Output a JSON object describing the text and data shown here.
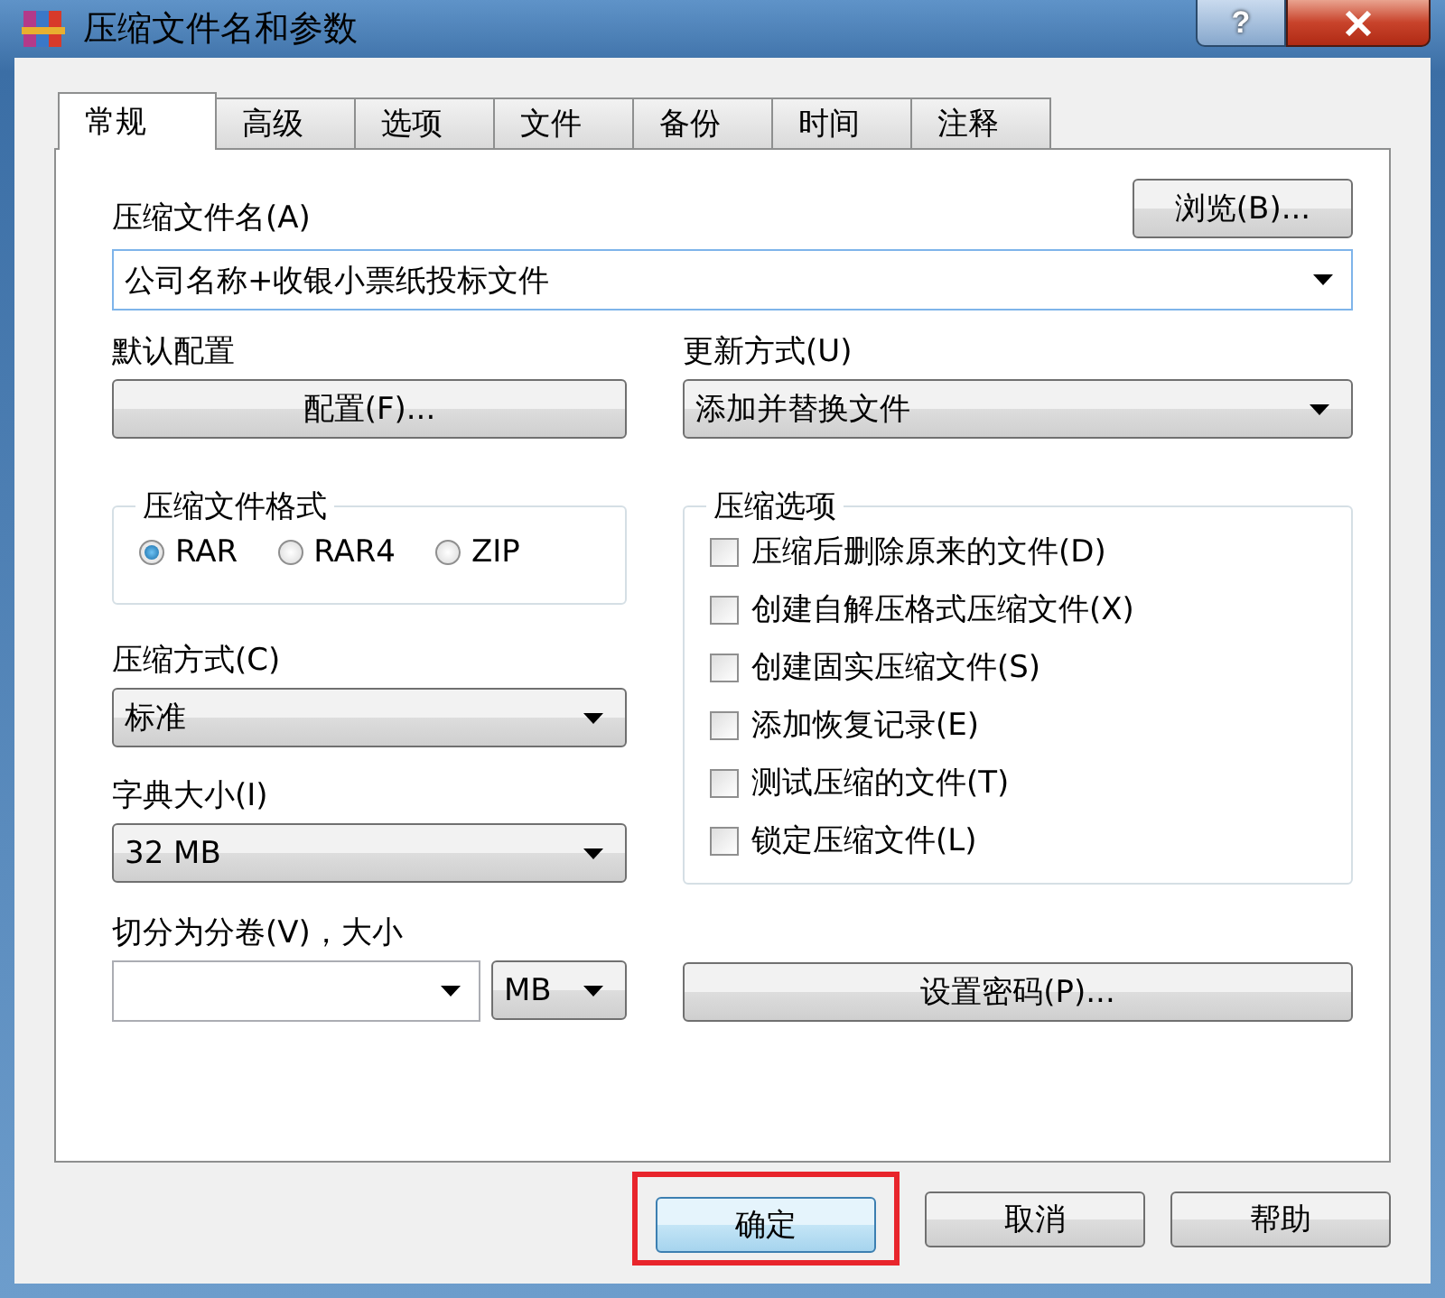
{
  "window": {
    "title": "压缩文件名和参数",
    "help_button": "?"
  },
  "tabs": [
    {
      "label": "常规",
      "selected": true
    },
    {
      "label": "高级",
      "selected": false
    },
    {
      "label": "选项",
      "selected": false
    },
    {
      "label": "文件",
      "selected": false
    },
    {
      "label": "备份",
      "selected": false
    },
    {
      "label": "时间",
      "selected": false
    },
    {
      "label": "注释",
      "selected": false
    }
  ],
  "archive_name": {
    "label": "压缩文件名(A)",
    "value": "公司名称+收银小票纸投标文件",
    "browse_button": "浏览(B)..."
  },
  "default_profile": {
    "label": "默认配置",
    "button": "配置(F)..."
  },
  "update_mode": {
    "label": "更新方式(U)",
    "value": "添加并替换文件"
  },
  "archive_format": {
    "legend": "压缩文件格式",
    "options": [
      {
        "label": "RAR",
        "selected": true
      },
      {
        "label": "RAR4",
        "selected": false
      },
      {
        "label": "ZIP",
        "selected": false
      }
    ]
  },
  "compression_method": {
    "label": "压缩方式(C)",
    "value": "标准"
  },
  "dictionary_size": {
    "label": "字典大小(I)",
    "value": "32 MB"
  },
  "split_volumes": {
    "label": "切分为分卷(V)，大小",
    "unit": "MB"
  },
  "archive_options": {
    "legend": "压缩选项",
    "options": [
      {
        "label": "压缩后删除原来的文件(D)",
        "checked": false
      },
      {
        "label": "创建自解压格式压缩文件(X)",
        "checked": false
      },
      {
        "label": "创建固实压缩文件(S)",
        "checked": false
      },
      {
        "label": "添加恢复记录(E)",
        "checked": false
      },
      {
        "label": "测试压缩的文件(T)",
        "checked": false
      },
      {
        "label": "锁定压缩文件(L)",
        "checked": false
      }
    ]
  },
  "set_password_button": "设置密码(P)...",
  "buttons": [
    {
      "label": "确定",
      "highlighted": true
    },
    {
      "label": "取消",
      "highlighted": false
    },
    {
      "label": "帮助",
      "highlighted": false
    }
  ]
}
